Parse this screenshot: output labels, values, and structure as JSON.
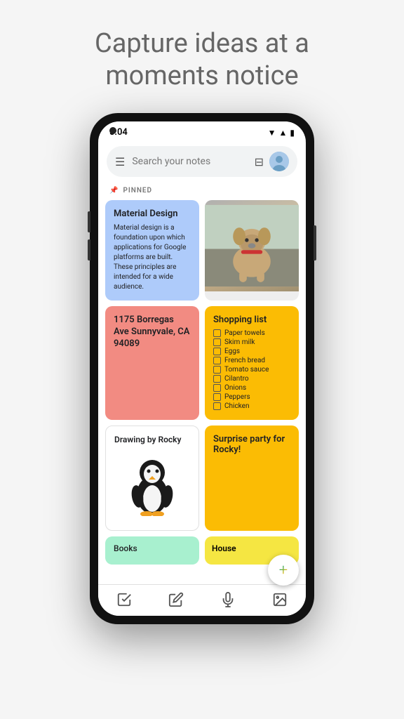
{
  "hero": {
    "title": "Capture ideas at a moments notice"
  },
  "phone": {
    "statusBar": {
      "time": "5:04",
      "icons": "▼▲■"
    },
    "searchBar": {
      "placeholder": "Search your notes",
      "menuIcon": "☰",
      "gridIcon": "⊟"
    },
    "pinnedLabel": "PINNED",
    "notes": [
      {
        "id": "material-design",
        "color": "blue",
        "title": "Material Design",
        "body": "Material design is a foundation upon which applications for Google platforms are built. These principles are intended for a wide audience.",
        "type": "text"
      },
      {
        "id": "dog-photo",
        "color": "photo",
        "type": "photo"
      },
      {
        "id": "address",
        "color": "red",
        "type": "address",
        "text": "1175 Borregas Ave Sunnyvale, CA 94089"
      },
      {
        "id": "shopping-list",
        "color": "yellow",
        "title": "Shopping list",
        "type": "checklist",
        "items": [
          "Paper towels",
          "Skim milk",
          "Eggs",
          "French bread",
          "Tomato sauce",
          "Cilantro",
          "Onions",
          "Peppers",
          "Chicken"
        ]
      },
      {
        "id": "drawing-rocky",
        "color": "white",
        "title": "Drawing by Rocky",
        "type": "drawing"
      },
      {
        "id": "surprise-party",
        "color": "yellow-bright",
        "title": "Surprise party for Rocky!",
        "type": "text"
      },
      {
        "id": "books",
        "color": "teal",
        "title": "Books",
        "type": "text"
      }
    ],
    "fab": "+",
    "bottomNav": {
      "icons": [
        "✓",
        "✏",
        "🎤",
        "🖼"
      ]
    }
  }
}
